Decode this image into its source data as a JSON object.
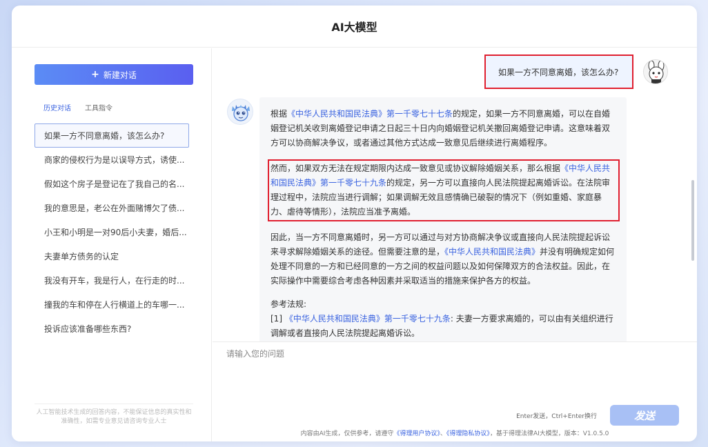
{
  "window": {
    "title": "AI大模型"
  },
  "sidebar": {
    "new_chat_label": "新建对话",
    "tabs": [
      {
        "label": "历史对话",
        "active": true
      },
      {
        "label": "工具指令",
        "active": false
      }
    ],
    "history": [
      "如果一方不同意离婚，该怎么办?",
      "商家的侵权行为是以误导方式，诱使...",
      "假如这个房子是登记在了我自己的名...",
      "我的意思是，老公在外面赌博欠了债...",
      "小王和小明是一对90后小夫妻，婚后...",
      "夫妻单方债务的认定",
      "我没有开车，我是行人，在行走的时...",
      "撞我的车和停在人行横道上的车哪一...",
      "投诉应该准备哪些东西?"
    ],
    "disclaimer": "人工智能技术生成的回答内容，不能保证信息的真实性和准确性，如需专业意见请咨询专业人士"
  },
  "chat": {
    "user_message": "如果一方不同意离婚，该怎么办?",
    "answer": {
      "p1": {
        "a": "根据",
        "link": "《中华人民共和国民法典》第一千零七十七条",
        "b": "的规定，如果一方不同意离婚，可以在自婚姻登记机关收到离婚登记申请之日起三十日内向婚姻登记机关撤回离婚登记申请。这意味着双方可以协商解决争议，或者通过其他方式达成一致意见后继续进行离婚程序。"
      },
      "p2": {
        "a": "然而，如果双方无法在规定期限内达成一致意见或协议解除婚姻关系，那么根据",
        "link": "《中华人民共和国民法典》第一千零七十九条",
        "b": "的规定，另一方可以直接向人民法院提起离婚诉讼。在法院审理过程中，法院应当进行调解；如果调解无效且感情确已破裂的情况下（例如重婚、家庭暴力、虐待等情形），法院应当准予离婚。"
      },
      "p3": {
        "a": "因此，当一方不同意离婚时，另一方可以通过与对方协商解决争议或直接向人民法院提起诉讼来寻求解除婚姻关系的途径。但需要注意的是，",
        "link": "《中华人民共和国民法典》",
        "b": "并没有明确规定如何处理不同意的一方和已经同意的一方之间的权益问题以及如何保障双方的合法权益。因此，在实际操作中需要综合考虑各种因素并采取适当的措施来保护各方的权益。"
      },
      "ref_title": "参考法规:",
      "ref1": {
        "num": "[1]",
        "link": "《中华人民共和国民法典》第一千零七十九条",
        "b": ": 夫妻一方要求离婚的，可以由有关组织进行调解或者直接向人民法院提起离婚诉讼。"
      }
    }
  },
  "composer": {
    "placeholder": "请输入您的问题",
    "hint": "Enter发送，Ctrl+Enter换行",
    "send_label": "发送",
    "footer": {
      "a": "内容由AI生成，仅供参考，请遵守",
      "link1": "《得理用户协议》",
      "sep": "、",
      "link2": "《得理隐私协议》",
      "b": "，基于得理法律AI大模型，版本：V1.0.5.0"
    }
  },
  "colors": {
    "accent": "#3a63e0",
    "highlight_border": "#e01e2e",
    "send_button": "#a8c0f5"
  }
}
